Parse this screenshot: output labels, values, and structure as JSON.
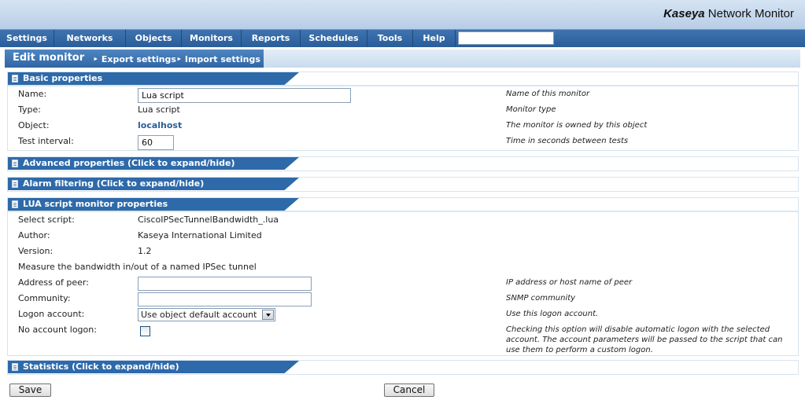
{
  "brand": {
    "name_bold": "Kaseya",
    "name_rest": "Network Monitor"
  },
  "menu": [
    "Settings",
    "Networks",
    "Objects",
    "Monitors",
    "Reports",
    "Schedules",
    "Tools",
    "Help"
  ],
  "search": {
    "value": ""
  },
  "title": {
    "text": "Edit monitor",
    "export": "Export settings",
    "import": "Import settings"
  },
  "basic": {
    "header": "Basic properties",
    "name_label": "Name:",
    "name_value": "Lua script",
    "name_hint": "Name of this monitor",
    "type_label": "Type:",
    "type_value": "Lua script",
    "type_hint": "Monitor type",
    "object_label": "Object:",
    "object_value": "localhost",
    "object_hint": "The monitor is owned by this object",
    "interval_label": "Test interval:",
    "interval_value": "60",
    "interval_hint": "Time in seconds between tests"
  },
  "advanced": {
    "header": "Advanced properties (Click to expand/hide)"
  },
  "alarm": {
    "header": "Alarm filtering (Click to expand/hide)"
  },
  "lua": {
    "header": "LUA script monitor properties",
    "script_label": "Select script:",
    "script_value": "CiscoIPSecTunnelBandwidth_.lua",
    "author_label": "Author:",
    "author_value": "Kaseya International Limited",
    "version_label": "Version:",
    "version_value": "1.2",
    "description": "Measure the bandwidth in/out of a named IPSec tunnel",
    "peer_label": "Address of peer:",
    "peer_value": "",
    "peer_hint": "IP address or host name of peer",
    "community_label": "Community:",
    "community_value": "",
    "community_hint": "SNMP community",
    "logon_label": "Logon account:",
    "logon_value": "Use object default account",
    "logon_hint": "Use this logon account.",
    "nologon_label": "No account logon:",
    "nologon_checked": false,
    "nologon_hint_1": "Checking this option will disable automatic logon with the selected",
    "nologon_hint_2": "account. The account parameters will be passed to the script that can",
    "nologon_hint_3": "use them to perform a custom logon."
  },
  "statistics": {
    "header": "Statistics (Click to expand/hide)"
  },
  "buttons": {
    "save": "Save",
    "cancel": "Cancel"
  }
}
